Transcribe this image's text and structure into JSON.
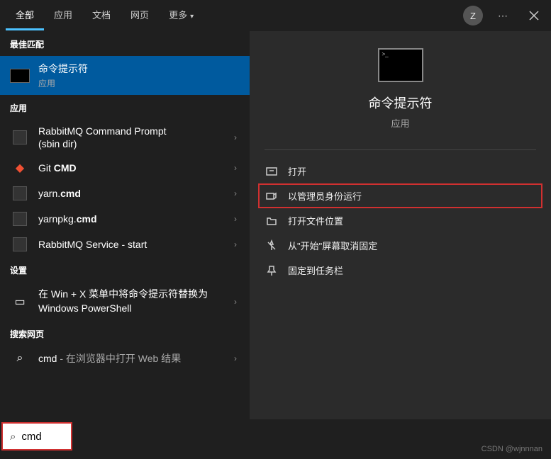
{
  "topbar": {
    "tabs": [
      "全部",
      "应用",
      "文档",
      "网页",
      "更多"
    ],
    "avatar": "Z"
  },
  "sections": {
    "best_match": "最佳匹配",
    "apps": "应用",
    "settings": "设置",
    "web": "搜索网页"
  },
  "best_match": {
    "title": "命令提示符",
    "sub": "应用"
  },
  "apps": [
    {
      "title_pre": "RabbitMQ Command Prompt",
      "title_post": "(sbin dir)"
    },
    {
      "title_pre": "Git ",
      "title_bold": "CMD"
    },
    {
      "title_pre": "yarn.",
      "title_bold": "cmd"
    },
    {
      "title_pre": "yarnpkg.",
      "title_bold": "cmd"
    },
    {
      "title_pre": "RabbitMQ Service - start"
    }
  ],
  "settings": [
    {
      "title": "在 Win + X 菜单中将命令提示符替换为 Windows PowerShell"
    }
  ],
  "web": {
    "query": "cmd",
    "suffix": " - 在浏览器中打开 Web 结果"
  },
  "preview": {
    "title": "命令提示符",
    "sub": "应用"
  },
  "actions": {
    "open": "打开",
    "run_admin": "以管理员身份运行",
    "open_location": "打开文件位置",
    "unpin_start": "从\"开始\"屏幕取消固定",
    "pin_taskbar": "固定到任务栏"
  },
  "search": {
    "value": "cmd"
  },
  "watermark": "CSDN @wjnnnan"
}
